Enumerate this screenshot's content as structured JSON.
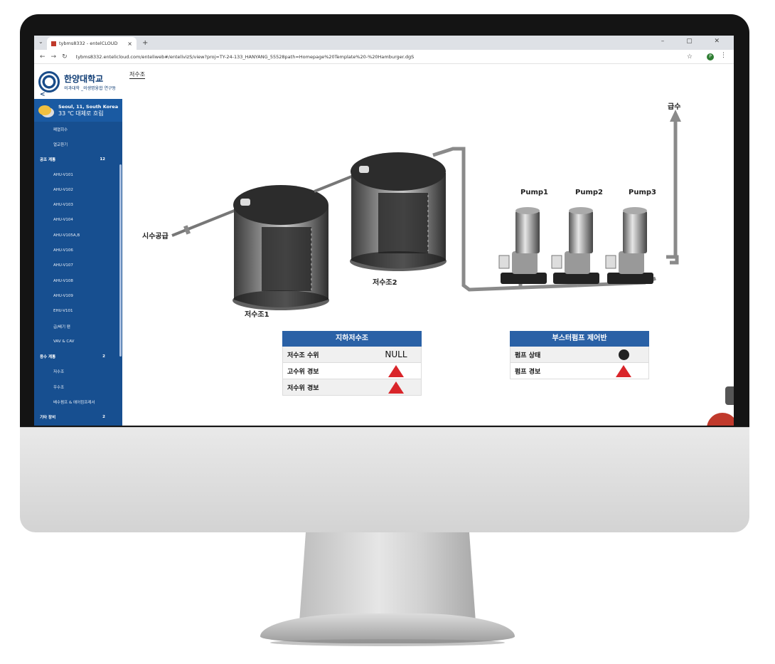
{
  "browser": {
    "tab_title": "tybms8332 - entelCLOUD",
    "tab_close": "×",
    "new_tab": "+",
    "url": "tybms8332.entelicloud.com/enteliweb#/entelivizS/view?proj=TY-24-133_HANYANG_55528path=Homepage%20Template%20-%20Hamburger.dgS",
    "window_controls": "–  ▢  ✕"
  },
  "sidebar": {
    "logo_main": "한양대학교",
    "logo_sub": "의과대학 _의생명융합 연구동",
    "collapse": "<",
    "weather": {
      "location": "Seoul, 11, South Korea",
      "temp": "33 ℃  대체로 흐림"
    },
    "items": [
      {
        "label": "폐열회수"
      },
      {
        "label": "열교환기"
      },
      {
        "label": "공조 계통",
        "count": "12",
        "group": true
      },
      {
        "label": "AHU-V101"
      },
      {
        "label": "AHU-V102"
      },
      {
        "label": "AHU-V103"
      },
      {
        "label": "AHU-V104"
      },
      {
        "label": "AHU-V105A,B"
      },
      {
        "label": "AHU-V106"
      },
      {
        "label": "AHU-V107"
      },
      {
        "label": "AHU-V108"
      },
      {
        "label": "AHU-V109"
      },
      {
        "label": "EHU-V101"
      },
      {
        "label": "급/배기 팬"
      },
      {
        "label": "VAV & CAV"
      },
      {
        "label": "용수 계통",
        "count": "2",
        "group": true
      },
      {
        "label": "저수조"
      },
      {
        "label": "우수조"
      },
      {
        "label": "배수펌프 & 에어컴프레서"
      },
      {
        "label": "기타 장비",
        "count": "2",
        "group": true
      }
    ]
  },
  "main": {
    "page_title": "저수조",
    "labels": {
      "supply_in": "시수공급",
      "supply_out": "급수",
      "tank1": "저수조1",
      "tank2": "저수조2",
      "pump1": "Pump1",
      "pump2": "Pump2",
      "pump3": "Pump3"
    },
    "tank_panel": {
      "title": "지하저수조",
      "rows": [
        {
          "label": "저수조 수위",
          "value": "NULL",
          "type": "text"
        },
        {
          "label": "고수위 경보",
          "type": "alarm"
        },
        {
          "label": "저수위 경보",
          "type": "alarm"
        }
      ]
    },
    "pump_panel": {
      "title": "부스터펌프 제어반",
      "rows": [
        {
          "label": "펌프 상태",
          "type": "status"
        },
        {
          "label": "펌프 경보",
          "type": "alarm"
        }
      ]
    }
  },
  "colors": {
    "sidebar": "#174f90",
    "panel_header": "#2a61a6",
    "alarm": "#d9252a",
    "status_off": "#222222"
  }
}
